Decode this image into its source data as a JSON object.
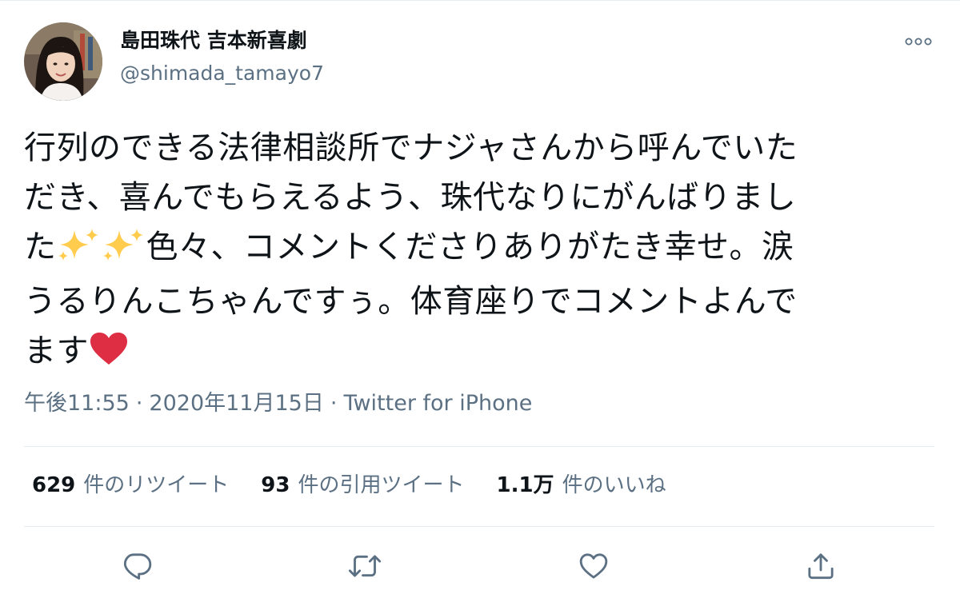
{
  "tweet": {
    "author": {
      "display_name": "島田珠代 吉本新喜劇",
      "handle": "@shimada_tamayo7"
    },
    "more_icon": "more-dots-icon",
    "text_lines": [
      "行列のできる法律相談所でナジャさんから呼んでいた",
      "だき、喜んでもらえるよう、珠代なりにがんばりまし",
      "た",
      "色々、コメントくださりありがたき幸せ。涙",
      "うるりんこちゃんですぅ。体育座りでコメントよんで",
      "ます"
    ],
    "emojis": [
      "sparkles",
      "sparkles",
      "red-heart"
    ],
    "meta": {
      "time": "午後11:55",
      "separator": "·",
      "date": "2020年11月15日",
      "source": "Twitter for iPhone"
    },
    "stats": [
      {
        "count": "629",
        "label": "件のリツイート"
      },
      {
        "count": "93",
        "label": "件の引用ツイート"
      },
      {
        "count": "1.1万",
        "label": "件のいいね"
      }
    ],
    "actions": [
      {
        "icon": "reply-icon"
      },
      {
        "icon": "retweet-icon"
      },
      {
        "icon": "like-icon"
      },
      {
        "icon": "share-icon"
      }
    ],
    "colors": {
      "text": "#0f1419",
      "secondary": "#5b7083",
      "divider": "#e6ecf0",
      "icon": "#5b7083",
      "sparkle": "#ffcc4d",
      "heart": "#dd2e44"
    }
  }
}
